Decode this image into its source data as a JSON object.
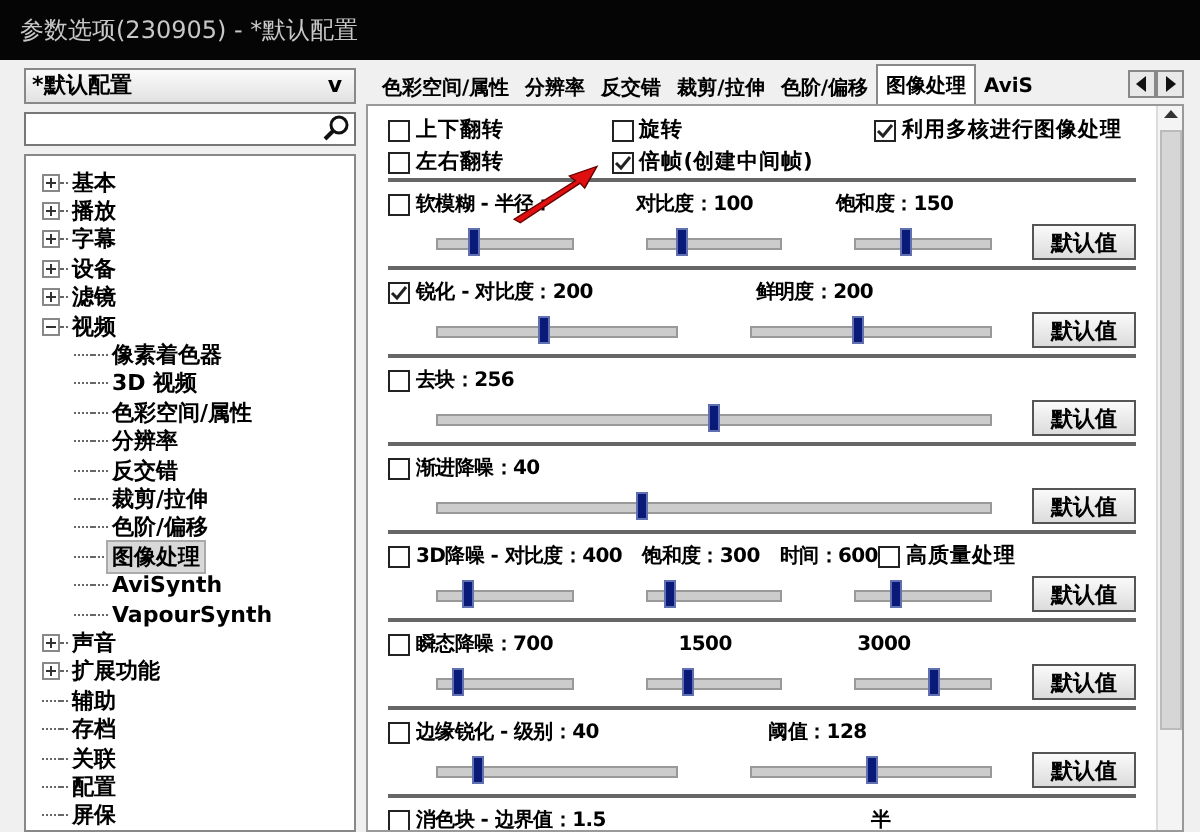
{
  "window": {
    "title": "参数选项(230905) - *默认配置"
  },
  "profile_select": {
    "value": "*默认配置",
    "caret": "v"
  },
  "tree": [
    {
      "label": "基本",
      "expanded": false
    },
    {
      "label": "播放",
      "expanded": false
    },
    {
      "label": "字幕",
      "expanded": false
    },
    {
      "label": "设备",
      "expanded": false
    },
    {
      "label": "滤镜",
      "expanded": false
    },
    {
      "label": "视频",
      "expanded": true,
      "children": [
        {
          "label": "像素着色器",
          "selected": false
        },
        {
          "label": "3D 视频",
          "selected": false
        },
        {
          "label": "色彩空间/属性",
          "selected": false
        },
        {
          "label": "分辨率",
          "selected": false
        },
        {
          "label": "反交错",
          "selected": false
        },
        {
          "label": "裁剪/拉伸",
          "selected": false
        },
        {
          "label": "色阶/偏移",
          "selected": false
        },
        {
          "label": "图像处理",
          "selected": true
        },
        {
          "label": "AviSynth",
          "selected": false
        },
        {
          "label": "VapourSynth",
          "selected": false
        }
      ]
    },
    {
      "label": "声音",
      "expanded": false
    },
    {
      "label": "扩展功能",
      "expanded": false
    },
    {
      "label": "辅助"
    },
    {
      "label": "存档"
    },
    {
      "label": "关联"
    },
    {
      "label": "配置"
    },
    {
      "label": "屏保"
    }
  ],
  "tabs": [
    {
      "label": "色彩空间/属性",
      "selected": false
    },
    {
      "label": "分辨率",
      "selected": false
    },
    {
      "label": "反交错",
      "selected": false
    },
    {
      "label": "裁剪/拉伸",
      "selected": false
    },
    {
      "label": "色阶/偏移",
      "selected": false
    },
    {
      "label": "图像处理",
      "selected": true
    },
    {
      "label": "AviS",
      "selected": false
    }
  ],
  "options": [
    [
      {
        "label": "上下翻转",
        "checked": false
      },
      {
        "label": "左右翻转",
        "checked": false
      }
    ],
    [
      {
        "label": "旋转",
        "checked": false
      },
      {
        "label": "倍帧(创建中间帧)",
        "checked": true
      }
    ],
    [
      {
        "label": "利用多核进行图像处理",
        "checked": true
      }
    ]
  ],
  "sections": [
    {
      "checked": false,
      "button": "默认值",
      "sliders": [
        {
          "caption": "软模糊 - 半径：",
          "level": 0.27
        },
        {
          "caption": "对比度：100",
          "level": 0.26
        },
        {
          "caption": "饱和度：150",
          "level": 0.37
        }
      ]
    },
    {
      "checked": true,
      "button": "默认值",
      "sliders": [
        {
          "caption": "锐化 - 对比度：200",
          "level": 0.45
        },
        {
          "caption": "鲜明度：200",
          "level": 0.45
        }
      ]
    },
    {
      "checked": false,
      "button": "默认值",
      "sliders": [
        {
          "caption": "去块：256",
          "level": 0.5
        }
      ]
    },
    {
      "checked": false,
      "button": "默认值",
      "sliders": [
        {
          "caption": "渐进降噪：40",
          "level": 0.37
        }
      ]
    },
    {
      "checked": false,
      "button": "默认值",
      "extra": {
        "label": "高质量处理",
        "checked": false
      },
      "sliders": [
        {
          "caption": "3D降噪 - 对比度：400",
          "level": 0.23
        },
        {
          "caption": "饱和度：300",
          "level": 0.18
        },
        {
          "caption": "时间：600",
          "level": 0.3
        }
      ]
    },
    {
      "checked": false,
      "button": "默认值",
      "sliders": [
        {
          "caption": "瞬态降噪：700",
          "level": 0.16
        },
        {
          "caption": "1500",
          "level": 0.31
        },
        {
          "caption": "3000",
          "level": 0.58
        }
      ]
    },
    {
      "checked": false,
      "button": "默认值",
      "sliders": [
        {
          "caption": "边缘锐化 - 级别：40",
          "level": 0.17
        },
        {
          "caption": "阈值：128",
          "level": 0.5
        }
      ]
    },
    {
      "checked": false,
      "sliders": [
        {
          "caption": "消色块 - 边界值：1.5"
        },
        {
          "caption": "半"
        }
      ]
    }
  ]
}
